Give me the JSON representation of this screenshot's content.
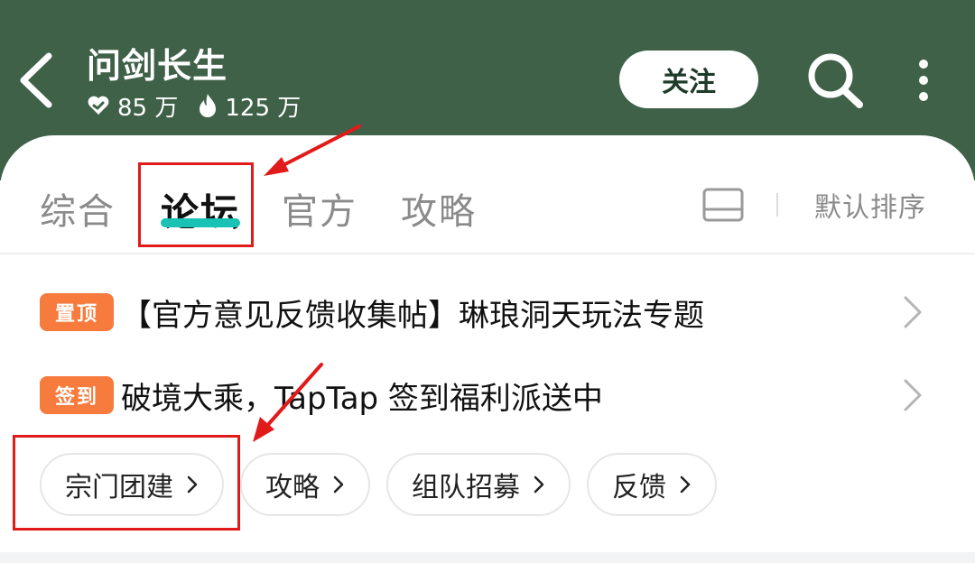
{
  "header": {
    "title": "问剑长生",
    "stats": [
      {
        "icon": "heart-icon",
        "value": "85 万"
      },
      {
        "icon": "flame-icon",
        "value": "125 万"
      }
    ],
    "follow_label": "关注",
    "bg_color": "#3f6148"
  },
  "tabs": [
    {
      "label": "综合",
      "active": false
    },
    {
      "label": "论坛",
      "active": true
    },
    {
      "label": "官方",
      "active": false
    },
    {
      "label": "攻略",
      "active": false
    }
  ],
  "sort_label": "默认排序",
  "posts": [
    {
      "badge": "置顶",
      "text": "【官方意见反馈收集帖】琳琅洞天玩法专题"
    },
    {
      "badge": "签到",
      "text": "破境大乘，TapTap 签到福利派送中"
    }
  ],
  "chips": [
    {
      "label": "宗门团建"
    },
    {
      "label": "攻略"
    },
    {
      "label": "组队招募"
    },
    {
      "label": "反馈"
    }
  ],
  "colors": {
    "accent_underline": "#19c2b4",
    "badge": "#f77b3d",
    "annotation": "#e11a1a"
  }
}
